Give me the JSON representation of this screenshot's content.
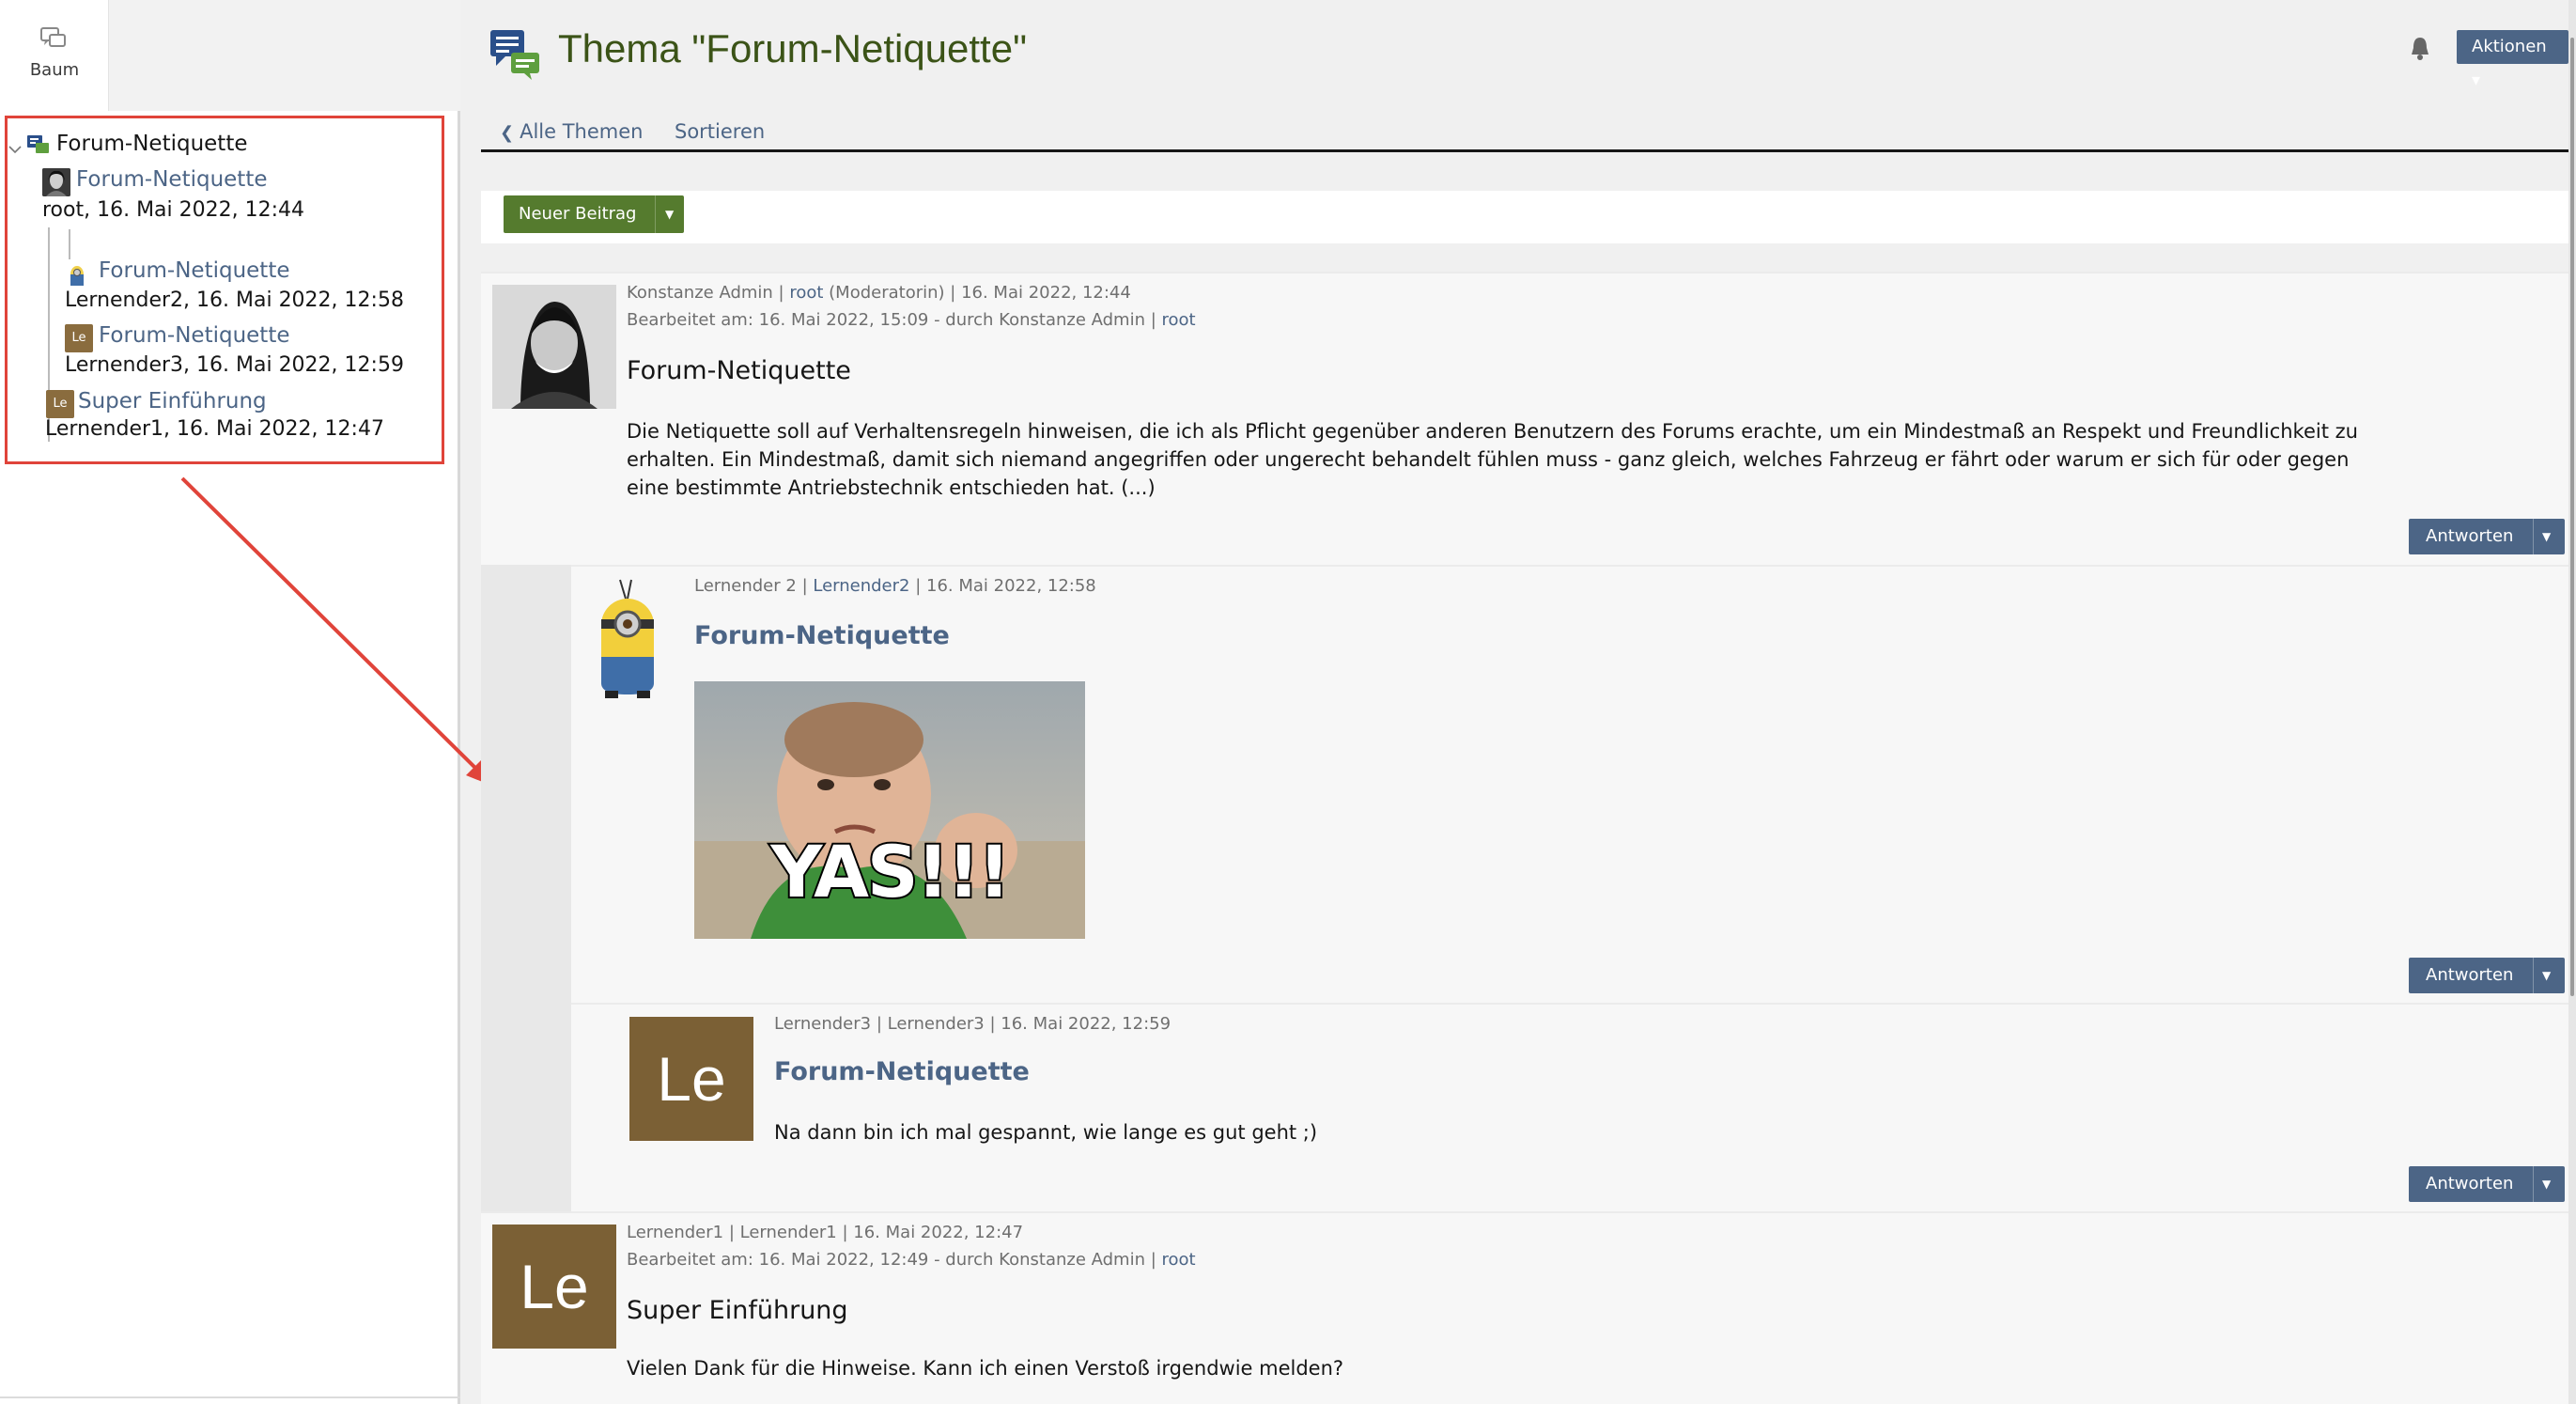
{
  "sidebar": {
    "tab_label": "Baum",
    "tree": {
      "root_label": "Forum-Netiquette",
      "items": [
        {
          "title": "Forum-Netiquette",
          "meta": "root, 16. Mai 2022, 12:44"
        },
        {
          "title": "Forum-Netiquette",
          "meta": "Lernender2, 16. Mai 2022, 12:58"
        },
        {
          "title": "Forum-Netiquette",
          "meta": "Lernender3, 16. Mai 2022, 12:59",
          "avatar_text": "Le"
        },
        {
          "title": "Super Einführung",
          "meta": "Lernender1, 16. Mai 2022, 12:47",
          "avatar_text": "Le"
        }
      ]
    }
  },
  "header": {
    "title": "Thema \"Forum-Netiquette\"",
    "actions_label": "Aktionen ▾",
    "tabs": {
      "back": "Alle Themen",
      "sort": "Sortieren"
    }
  },
  "toolbar": {
    "new_post_label": "Neuer Beitrag"
  },
  "posts": [
    {
      "author": "Konstanze Admin",
      "login": "root",
      "role": "(Moderatorin)",
      "date": "16. Mai 2022, 12:44",
      "edited": "Bearbeitet am: 16. Mai 2022, 15:09 - durch Konstanze Admin |",
      "edited_login": "root",
      "title": "Forum-Netiquette",
      "body": "Die Netiquette soll auf Verhaltensregeln hinweisen, die ich als Pflicht gegenüber anderen Benutzern des Forums erachte, um ein Mindestmaß an Respekt und Freundlichkeit zu erhalten. Ein Mindestmaß, damit sich niemand angegriffen oder ungerecht behandelt fühlen muss - ganz gleich, welches Fahrzeug er fährt oder warum er sich für oder gegen eine bestimmte Antriebstechnik entschieden hat. (...)",
      "reply_label": "Antworten"
    },
    {
      "author": "Lernender 2",
      "login": "Lernender2",
      "date": "16. Mai 2022, 12:58",
      "title": "Forum-Netiquette",
      "image_caption": "YAS!!!",
      "reply_label": "Antworten"
    },
    {
      "author": "Lernender3",
      "login": "Lernender3",
      "date": "16. Mai 2022, 12:59",
      "avatar_text": "Le",
      "title": "Forum-Netiquette",
      "body": "Na dann bin ich mal gespannt, wie lange es gut geht ;)",
      "reply_label": "Antworten"
    },
    {
      "author": "Lernender1",
      "login": "Lernender1",
      "date": "16. Mai 2022, 12:47",
      "avatar_text": "Le",
      "edited": "Bearbeitet am: 16. Mai 2022, 12:49 - durch Konstanze Admin |",
      "edited_login": "root",
      "title": "Super Einführung",
      "body": "Vielen Dank für die Hinweise. Kann ich einen Verstoß irgendwie melden?"
    }
  ],
  "colors": {
    "link": "#4c6586",
    "title_green": "#3b5317",
    "button_green": "#557b2e",
    "highlight_red": "#e0443a",
    "avatar_brown": "#7b6035"
  }
}
